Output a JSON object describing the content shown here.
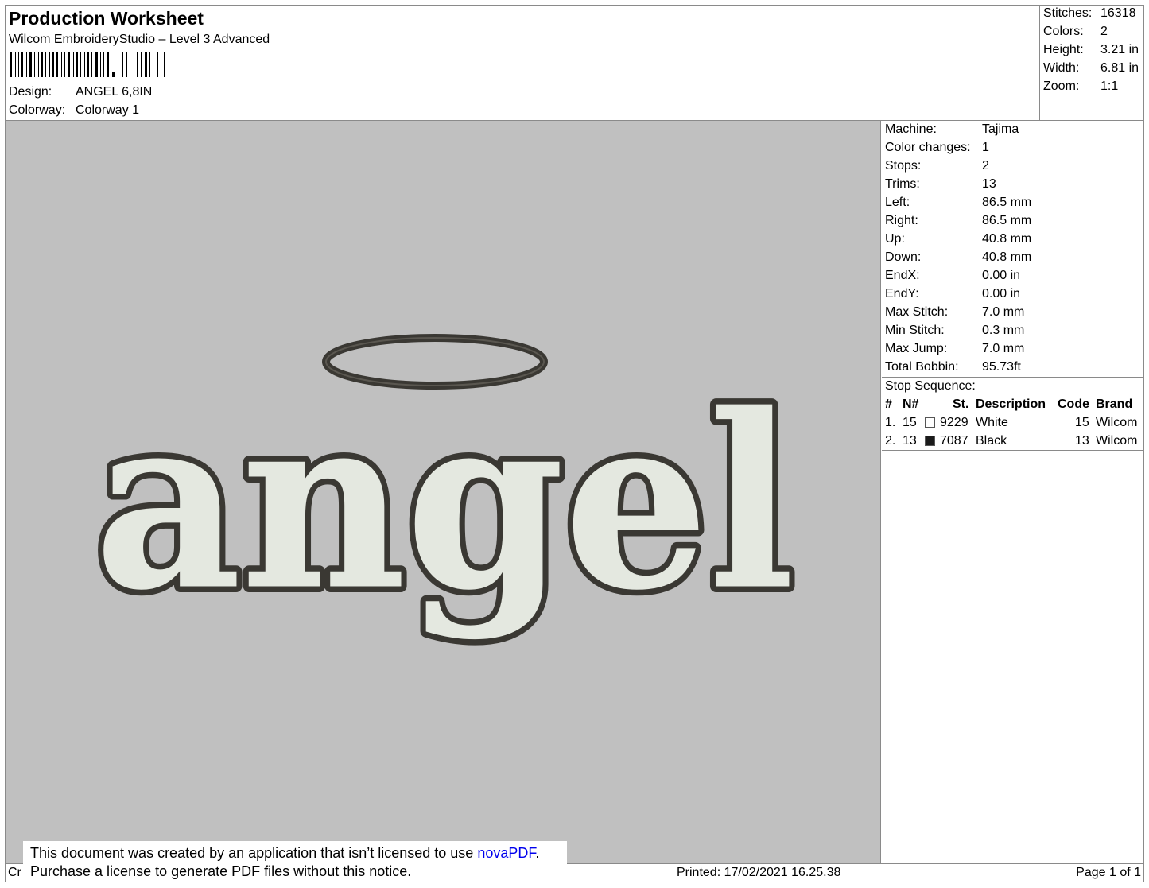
{
  "header": {
    "title": "Production Worksheet",
    "subtitle": "Wilcom EmbroideryStudio – Level 3 Advanced",
    "barcode_label": "barcode",
    "design_label": "Design:",
    "design_value": "ANGEL 6,8IN",
    "colorway_label": "Colorway:",
    "colorway_value": "Colorway 1"
  },
  "stats": [
    {
      "label": "Stitches:",
      "value": "16318"
    },
    {
      "label": "Colors:",
      "value": "2"
    },
    {
      "label": "Height:",
      "value": "3.21 in"
    },
    {
      "label": "Width:",
      "value": "6.81 in"
    },
    {
      "label": "Zoom:",
      "value": "1:1"
    }
  ],
  "machine_info": [
    {
      "label": "Machine:",
      "value": "Tajima"
    },
    {
      "label": "Color changes:",
      "value": "1"
    },
    {
      "label": "Stops:",
      "value": "2"
    },
    {
      "label": "Trims:",
      "value": "13"
    },
    {
      "label": "Left:",
      "value": "86.5 mm"
    },
    {
      "label": "Right:",
      "value": "86.5 mm"
    },
    {
      "label": "Up:",
      "value": "40.8 mm"
    },
    {
      "label": "Down:",
      "value": "40.8 mm"
    },
    {
      "label": "EndX:",
      "value": "0.00 in"
    },
    {
      "label": "EndY:",
      "value": "0.00 in"
    },
    {
      "label": "Max Stitch:",
      "value": "7.0 mm"
    },
    {
      "label": "Min Stitch:",
      "value": "0.3 mm"
    },
    {
      "label": "Max Jump:",
      "value": "7.0 mm"
    },
    {
      "label": "Total Bobbin:",
      "value": "95.73ft"
    }
  ],
  "stop_sequence": {
    "title": "Stop Sequence:",
    "headers": {
      "num": "#",
      "n": "N#",
      "st": "St.",
      "description": "Description",
      "code": "Code",
      "brand": "Brand"
    },
    "rows": [
      {
        "num": "1.",
        "n": "15",
        "color": "#ffffff",
        "st": "9229",
        "description": "White",
        "code": "15",
        "brand": "Wilcom"
      },
      {
        "num": "2.",
        "n": "13",
        "color": "#1a1a1a",
        "st": "7087",
        "description": "Black",
        "code": "13",
        "brand": "Wilcom"
      }
    ]
  },
  "design_preview": {
    "text": "angel",
    "background": "#c0c0c0",
    "fill_color": "#e4e8e0",
    "outline_color": "#3a3833"
  },
  "footer": {
    "left_text": "Cr",
    "printed": "Printed: 17/02/2021 16.25.38",
    "page": "Page 1 of 1"
  },
  "notice": {
    "line1_prefix": "This document was created by an application that isn’t licensed to use ",
    "link": "novaPDF",
    "line1_suffix": ".",
    "line2": "Purchase a license to generate PDF files without this notice."
  }
}
